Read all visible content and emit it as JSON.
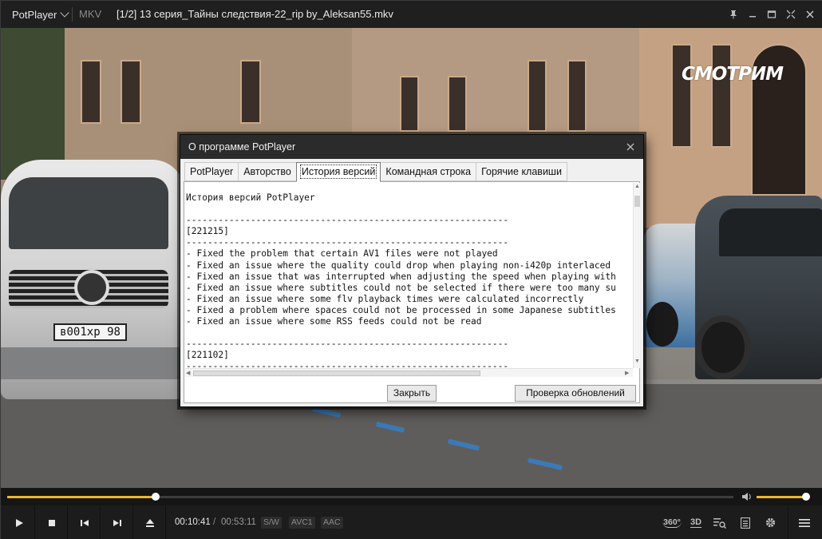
{
  "titlebar": {
    "app_name": "PotPlayer",
    "format": "MKV",
    "title": "[1/2] 13 серия_Тайны следствия-22_rip by_Aleksan55.mkv"
  },
  "video": {
    "watermark": "СМОТРИМ",
    "plate": "в001хр 98"
  },
  "dialog": {
    "title": "О программе PotPlayer",
    "tabs": [
      "PotPlayer",
      "Авторство",
      "История версий",
      "Командная строка",
      "Горячие клавиши"
    ],
    "active_tab": "История версий",
    "content": "История версий PotPlayer\n\n------------------------------------------------------------\n[221215]\n------------------------------------------------------------\n- Fixed the problem that certain AV1 files were not played\n- Fixed an issue where the quality could drop when playing non-i420p interlaced\n- Fixed an issue that was interrupted when adjusting the speed when playing with\n- Fixed an issue where subtitles could not be selected if there were too many su\n- Fixed an issue where some flv playback times were calculated incorrectly\n- Fixed a problem where spaces could not be processed in some Japanese subtitles\n- Fixed an issue where some RSS feeds could not be read\n\n------------------------------------------------------------\n[221102]\n------------------------------------------------------------",
    "close_label": "Закрыть",
    "check_updates_label": "Проверка обновлений"
  },
  "playback": {
    "current_time": "00:10:41",
    "separator": "/",
    "total_time": "00:53:11",
    "progress_fraction": 0.204,
    "volume_fraction": 0.94,
    "badges": [
      "S/W",
      "AVC1",
      "AAC"
    ]
  },
  "right_controls": {
    "vr_label": "360°",
    "threed_label": "3D"
  },
  "colors": {
    "accent": "#e8b923",
    "titlebar_bg": "#1f1f1f",
    "dialog_header_bg": "#2b2b2b"
  }
}
